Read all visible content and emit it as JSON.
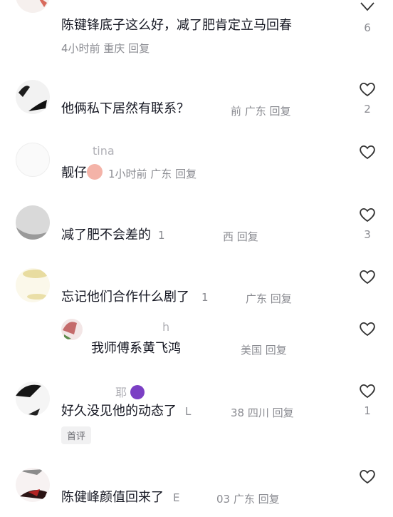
{
  "comments": [
    {
      "body": "陈键锋底子这么好，减了肥肯定立马回春",
      "meta": "4小时前 重庆 回复",
      "likes": "6"
    },
    {
      "body": "他俩私下居然有联系？",
      "meta": "前 广东 回复",
      "likes": "2"
    },
    {
      "name": "tina",
      "body": "靓仔",
      "meta": "1小时前 广东 回复",
      "likes": ""
    },
    {
      "body": "减了肥不会差的",
      "meta_left": "1",
      "meta": "西 回复",
      "likes": "3"
    },
    {
      "body": "忘记他们合作什么剧了",
      "meta_left": "1",
      "meta": "广东 回复",
      "likes": ""
    },
    {
      "name": "h",
      "body": "我师傅系黄飞鸿",
      "meta": "美国 回复",
      "likes": ""
    },
    {
      "name": "耶",
      "body": "好久没见他的动态了",
      "meta_left": "L",
      "meta": "38 四川 回复",
      "badge": "首评",
      "likes": "1"
    },
    {
      "body": "陈健峰颜值回来了",
      "meta_left": "E",
      "meta": "03 广东 回复",
      "likes": ""
    }
  ]
}
